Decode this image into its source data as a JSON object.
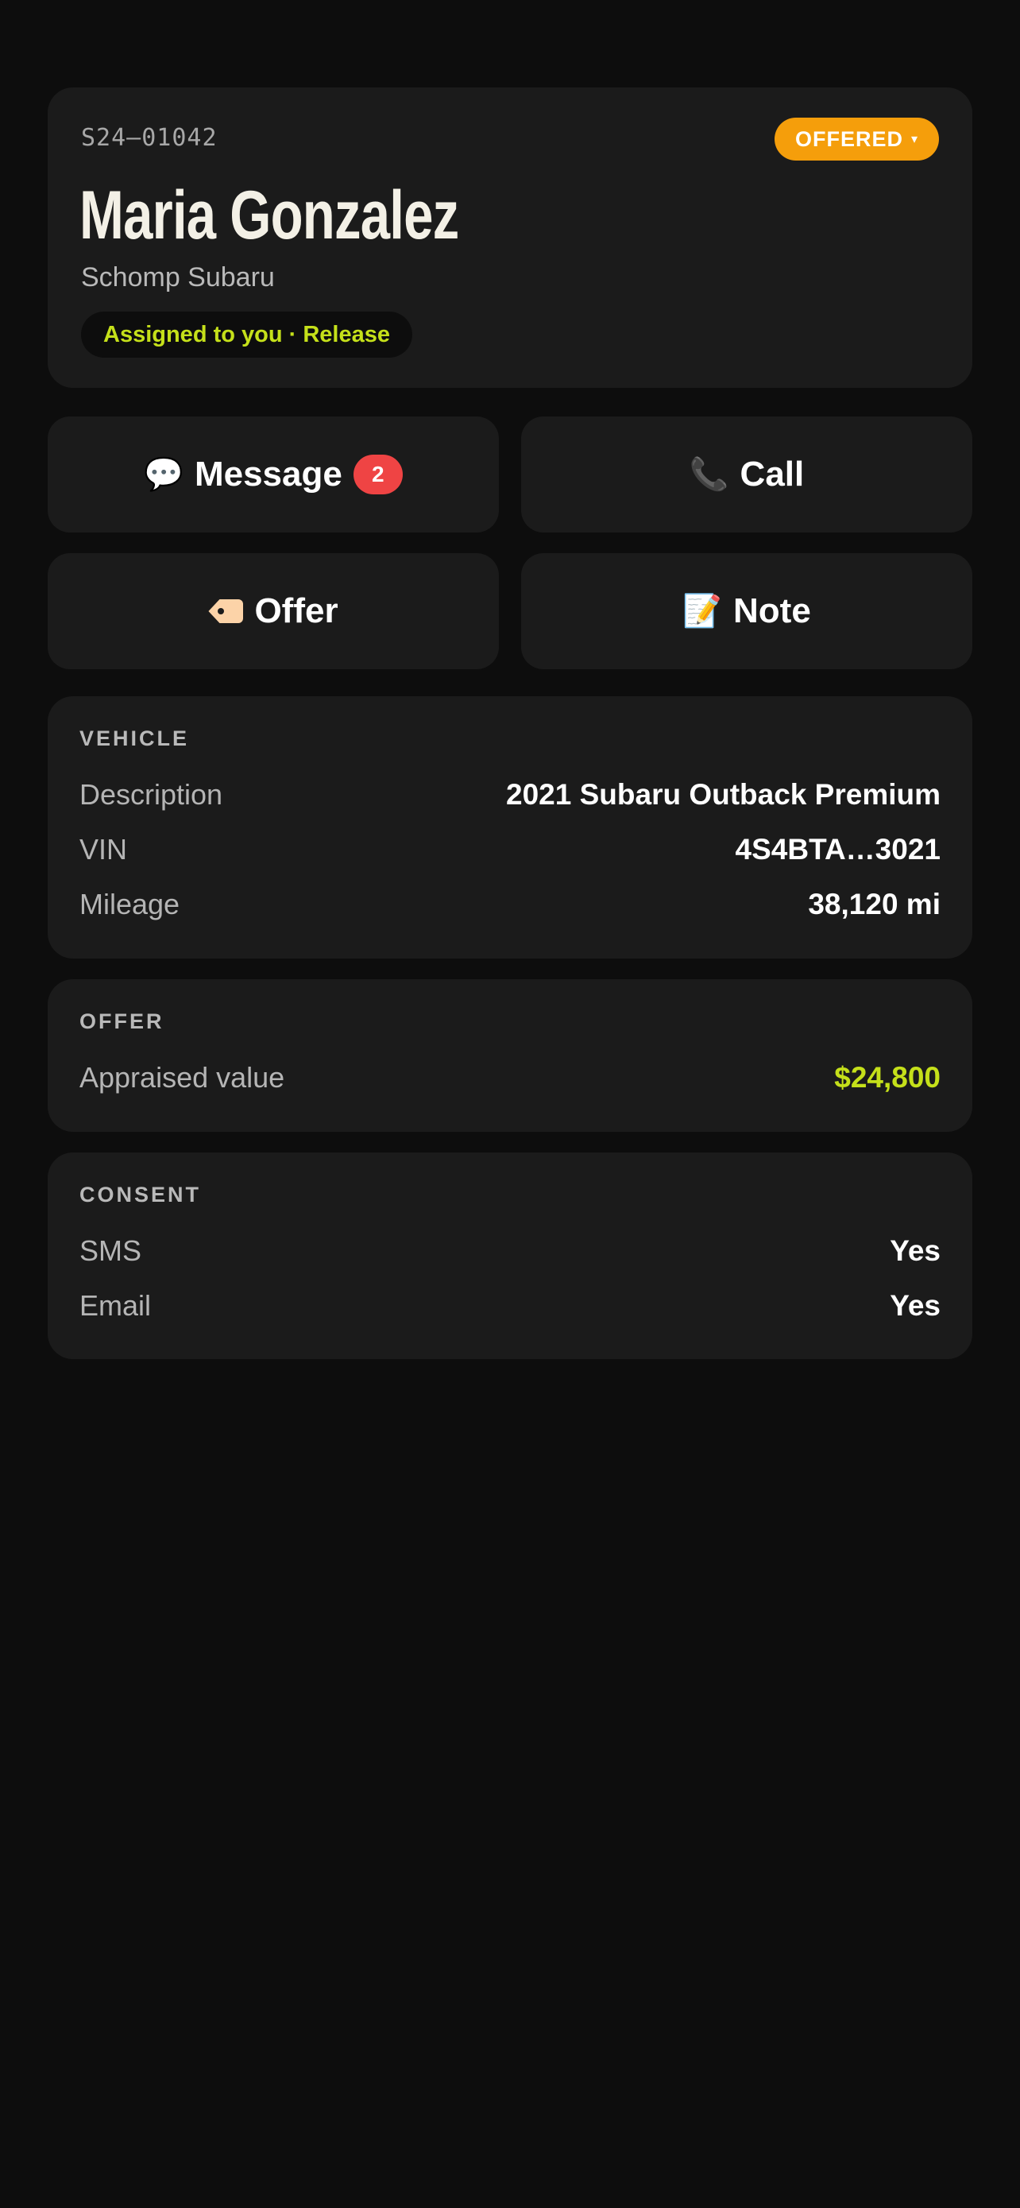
{
  "header": {
    "ref_id": "S24–01042",
    "status": "OFFERED",
    "status_caret": "▾",
    "customer_name": "Maria Gonzalez",
    "dealer": "Schomp Subaru",
    "assignment": "Assigned to you · Release"
  },
  "actions": {
    "message_label": "Message",
    "message_icon": "💬",
    "message_badge": "2",
    "call_label": "Call",
    "call_icon": "📞",
    "offer_label": "Offer",
    "offer_icon": "tag-icon",
    "note_label": "Note",
    "note_icon": "📝"
  },
  "vehicle": {
    "title": "VEHICLE",
    "rows": [
      {
        "label": "Description",
        "value": "2021 Subaru Outback Premium"
      },
      {
        "label": "VIN",
        "value": "4S4BTA…3021"
      },
      {
        "label": "Mileage",
        "value": "38,120 mi"
      }
    ]
  },
  "offer": {
    "title": "OFFER",
    "rows": [
      {
        "label": "Appraised value",
        "value": "$24,800"
      }
    ]
  },
  "consent": {
    "title": "CONSENT",
    "rows": [
      {
        "label": "SMS",
        "value": "Yes"
      },
      {
        "label": "Email",
        "value": "Yes"
      }
    ]
  },
  "colors": {
    "background": "#0d0d0d",
    "card": "#1b1b1b",
    "status_orange": "#f59e0b",
    "accent_lime": "#c5e01a",
    "badge_red": "#ef4444"
  }
}
